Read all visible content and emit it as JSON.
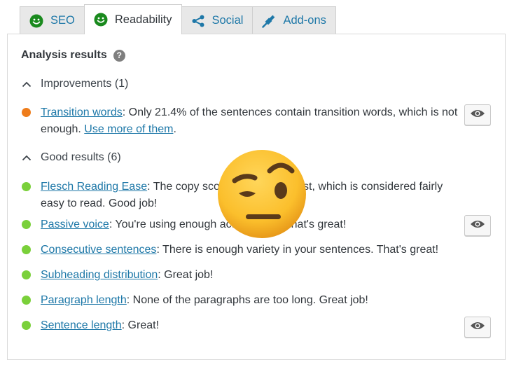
{
  "tabs": [
    {
      "label": "SEO",
      "icon": "smiley-icon",
      "active": false
    },
    {
      "label": "Readability",
      "icon": "smiley-icon",
      "active": true
    },
    {
      "label": "Social",
      "icon": "share-icon",
      "active": false
    },
    {
      "label": "Add-ons",
      "icon": "plug-icon",
      "active": false
    }
  ],
  "analysis": {
    "title": "Analysis results",
    "help_icon": "?"
  },
  "improvements": {
    "header": "Improvements (1)",
    "items": [
      {
        "link": "Transition words",
        "text": ": Only 21.4% of the sentences contain transition words, which is not enough. ",
        "link2": "Use more of them",
        "text2": ".",
        "status": "orange"
      }
    ]
  },
  "good_results": {
    "header": "Good results (6)",
    "items": [
      {
        "link": "Flesch Reading Ease",
        "text": ": The copy scores 69.6 in the test, which is considered fairly easy to read. Good job!",
        "status": "green"
      },
      {
        "link": "Passive voice",
        "text": ": You're using enough active voice. That's great!",
        "status": "green"
      },
      {
        "link": "Consecutive sentences",
        "text": ": There is enough variety in your sentences. That's great!",
        "status": "green"
      },
      {
        "link": "Subheading distribution",
        "text": ": Great job!",
        "status": "green"
      },
      {
        "link": "Paragraph length",
        "text": ": None of the paragraphs are too long. Great job!",
        "status": "green"
      },
      {
        "link": "Sentence length",
        "text": ": Great!",
        "status": "green"
      }
    ]
  },
  "colors": {
    "link": "#1e78a8",
    "orange": "#ee7c1b",
    "green": "#7ad03a",
    "smiley_green": "#1a8a1e"
  },
  "overlay": {
    "icon": "raised-eyebrow-emoji"
  }
}
